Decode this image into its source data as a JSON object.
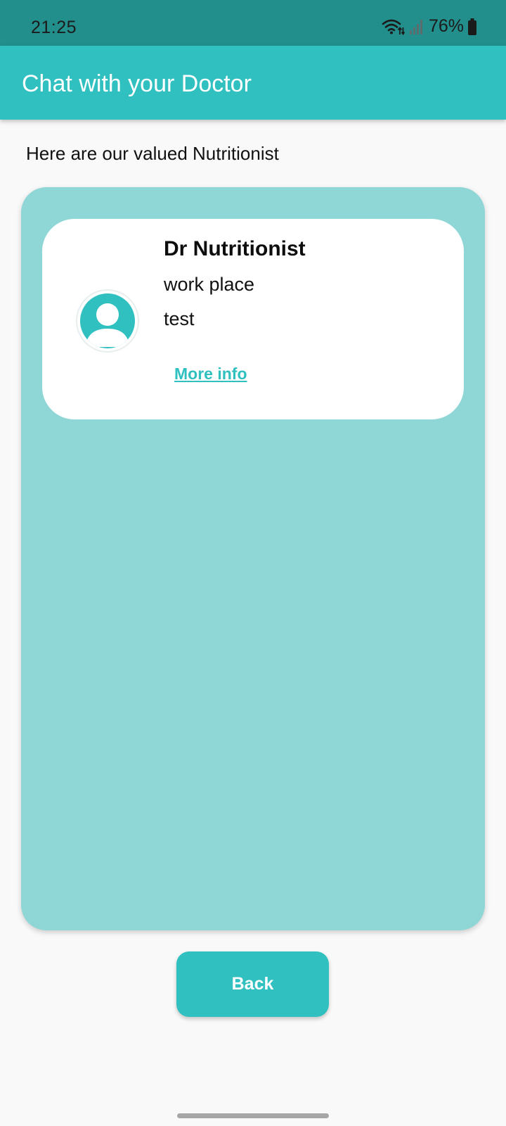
{
  "status_bar": {
    "time": "21:25",
    "battery": "76%",
    "icons": [
      "wifi-icon",
      "signal-icon",
      "battery-icon"
    ]
  },
  "app_bar": {
    "title": "Chat with your Doctor"
  },
  "intro": {
    "text": "Here are our valued Nutritionist"
  },
  "doctors": [
    {
      "name": "Dr Nutritionist",
      "workplace": "work place",
      "extra": "test",
      "more_info_label": "More info",
      "avatar_icon": "user-avatar-icon"
    }
  ],
  "back_button": {
    "label": "Back"
  },
  "colors": {
    "primary": "#31c0c0",
    "status_bar": "#238f8c",
    "panel": "#8fd6d6",
    "background": "#f9f9f9"
  }
}
